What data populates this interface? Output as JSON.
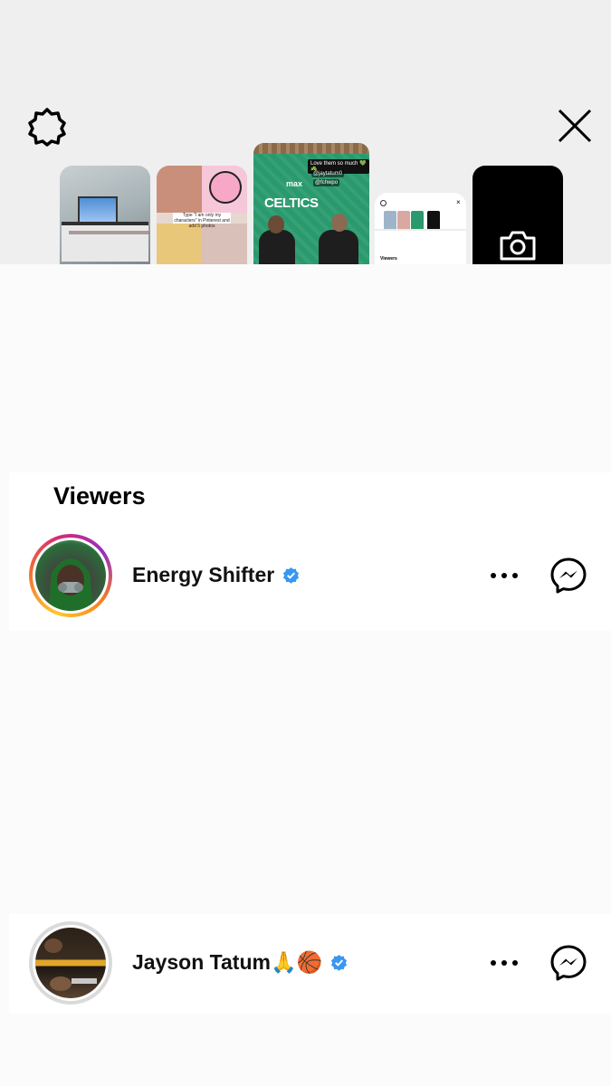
{
  "top": {
    "settings_icon": "gear-icon",
    "close_icon": "close-icon",
    "thumbnails": {
      "story3_text_main": "CELTICS",
      "story3_brand": "max",
      "story3_sticker": "Love them so much 💚☘️",
      "story3_tag1": "@jaytatum0",
      "story3_tag2": "@fchwpo",
      "story2_caption": "Type \"I am only my characters\" in Pinterest and add 5 photos",
      "story4_label": "Viewers",
      "camera_icon": "camera-icon"
    }
  },
  "viewers": {
    "title": "Viewers",
    "items": [
      {
        "name": "Energy Shifter",
        "verified": true,
        "has_story_ring": true,
        "more_icon": "more-icon",
        "message_icon": "messenger-icon"
      },
      {
        "name": "Jayson Tatum🙏🏀",
        "verified": true,
        "has_story_ring": false,
        "more_icon": "more-icon",
        "message_icon": "messenger-icon"
      }
    ]
  },
  "colors": {
    "verified": "#3897f0",
    "background": "#fbfbfb",
    "top_bg": "#efefef"
  }
}
